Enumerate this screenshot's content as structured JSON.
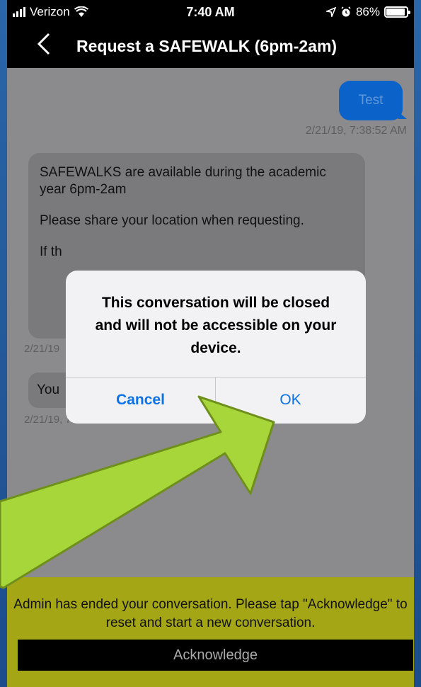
{
  "status_bar": {
    "carrier": "Verizon",
    "time": "7:40 AM",
    "battery": "86%",
    "icons": [
      "signal-icon",
      "wifi-icon",
      "location-icon",
      "alarm-icon",
      "battery-icon"
    ]
  },
  "nav": {
    "back_icon": "chevron-left-icon",
    "title": "Request a SAFEWALK (6pm-2am)"
  },
  "messages": [
    {
      "direction": "outgoing",
      "text": "Test",
      "timestamp": "2/21/19, 7:38:52 AM"
    },
    {
      "direction": "incoming",
      "lines": [
        "SAFEWALKS are available during the academic year 6pm-2am",
        "Please share your location when requesting.",
        "If th"
      ],
      "timestamp": "2/21/19"
    },
    {
      "direction": "incoming",
      "text": "You",
      "timestamp": "2/21/19, 7:40:16 AM"
    }
  ],
  "alert": {
    "message": "This conversation will be closed and will not be accessible on your device.",
    "cancel_label": "Cancel",
    "ok_label": "OK"
  },
  "banner": {
    "message": "Admin has ended your conversation. Please tap \"Acknowledge\" to reset and start a new conversation.",
    "acknowledge_label": "Acknowledge"
  },
  "colors": {
    "frame_blue": "#1d4f8f",
    "outgoing_bubble": "#0b63c9",
    "alert_button": "#0b72e7",
    "banner": "#a4a615",
    "arrow_fill": "#a6d63a",
    "arrow_stroke": "#6f8f1c"
  }
}
